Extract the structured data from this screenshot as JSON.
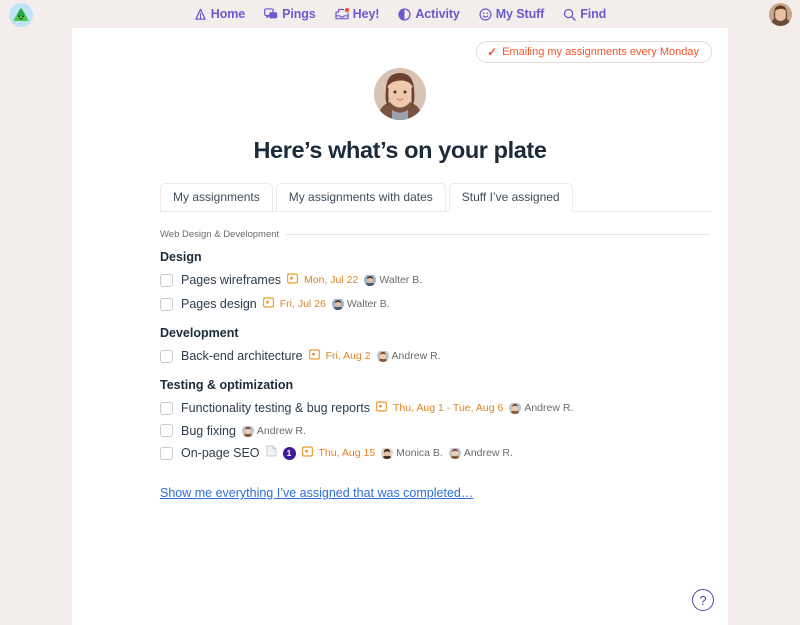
{
  "brand": {
    "logo_icon": "basecamp-tent-logo",
    "accent_purple": "#6a5acd",
    "accent_orange": "#f5542a",
    "date_orange": "#e08325",
    "link_blue": "#2e6fd9",
    "badge_purple": "#3c1a9c"
  },
  "nav": {
    "items": [
      {
        "label": "Home",
        "icon": "tent-icon"
      },
      {
        "label": "Pings",
        "icon": "chat-bubbles-icon"
      },
      {
        "label": "Hey!",
        "icon": "inbox-icon",
        "badge": true
      },
      {
        "label": "Activity",
        "icon": "half-circle-icon"
      },
      {
        "label": "My Stuff",
        "icon": "smiley-face-icon"
      },
      {
        "label": "Find",
        "icon": "magnifying-glass-icon"
      }
    ],
    "account_avatar": "user-avatar"
  },
  "notice": {
    "check_glyph": "✓",
    "label": "Emailing my assignments every Monday"
  },
  "hero": {
    "avatar": "profile-avatar",
    "title": "Here’s what’s on your plate"
  },
  "tabs": [
    {
      "label": "My assignments",
      "active": false
    },
    {
      "label": "My assignments with dates",
      "active": false
    },
    {
      "label": "Stuff I’ve assigned",
      "active": true
    }
  ],
  "project": {
    "name": "Web Design & Development"
  },
  "groups": [
    {
      "title": "Design",
      "todos": [
        {
          "title": "Pages wireframes",
          "date": "Mon, Jul 22",
          "assignees": [
            {
              "name": "Walter B."
            }
          ],
          "doc": false,
          "count": null
        },
        {
          "title": "Pages design",
          "date": "Fri, Jul 26",
          "assignees": [
            {
              "name": "Walter B."
            }
          ],
          "doc": false,
          "count": null
        }
      ]
    },
    {
      "title": "Development",
      "todos": [
        {
          "title": "Back-end architecture",
          "date": "Fri, Aug 2",
          "assignees": [
            {
              "name": "Andrew R."
            }
          ],
          "doc": false,
          "count": null
        }
      ]
    },
    {
      "title": "Testing & optimization",
      "todos": [
        {
          "title": "Functionality testing & bug reports",
          "date": "Thu, Aug 1 - Tue, Aug 6",
          "assignees": [
            {
              "name": "Andrew R."
            }
          ],
          "doc": false,
          "count": null
        },
        {
          "title": "Bug fixing",
          "date": null,
          "assignees": [
            {
              "name": "Andrew R."
            }
          ],
          "doc": false,
          "count": null
        },
        {
          "title": "On-page SEO",
          "date": "Thu, Aug 15",
          "assignees": [
            {
              "name": "Monica B."
            },
            {
              "name": "Andrew R."
            }
          ],
          "doc": true,
          "count": "1"
        }
      ]
    }
  ],
  "footer": {
    "completed_link": "Show me everything I’ve assigned that was completed…"
  },
  "help": {
    "glyph": "?"
  }
}
